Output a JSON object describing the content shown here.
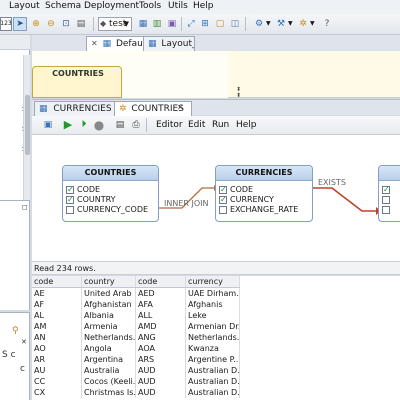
{
  "menu": [
    "Layout",
    "Schema",
    "Deployment",
    "Tools",
    "Utils",
    "Help"
  ],
  "toolbar": {
    "zoom_badge": "123",
    "database": "test"
  },
  "editor_tabs": [
    "Default",
    "Layout_"
  ],
  "layout_preview": {
    "entity": "COUNTRIES"
  },
  "query_tabs": [
    "CURRENCIES",
    "COUNTRIES"
  ],
  "query_menu": [
    "Editor",
    "Edit",
    "Run",
    "Help"
  ],
  "diagram": {
    "entities": [
      {
        "name": "COUNTRIES",
        "columns": [
          "CODE",
          "COUNTRY",
          "CURRENCY_CODE"
        ],
        "checked": [
          true,
          true,
          false
        ]
      },
      {
        "name": "CURRENCIES",
        "columns": [
          "CODE",
          "CURRENCY",
          "EXCHANGE_RATE"
        ],
        "checked": [
          true,
          true,
          false
        ]
      }
    ],
    "joins": [
      "INNER JOIN",
      "EXISTS"
    ],
    "colors": {
      "inner_join": "#b46a3c",
      "exists": "#c0402a",
      "arrow": "#2a9a30"
    }
  },
  "status": "Read 234 rows.",
  "results": {
    "columns": [
      "code",
      "country",
      "code",
      "currency"
    ],
    "rows": [
      [
        "AE",
        "United Arab ...",
        "AED",
        "UAE Dirham..."
      ],
      [
        "AF",
        "Afghanistan",
        "AFA",
        "Afghanis"
      ],
      [
        "AL",
        "Albania",
        "ALL",
        "Leke"
      ],
      [
        "AM",
        "Armenia",
        "AMD",
        "Armenian Dr..."
      ],
      [
        "AN",
        "Netherlands...",
        "ANG",
        "Netherlands..."
      ],
      [
        "AO",
        "Angola",
        "AOA",
        "Kwanza"
      ],
      [
        "AR",
        "Argentina",
        "ARS",
        "Argentine P..."
      ],
      [
        "AU",
        "Australia",
        "AUD",
        "Australian D..."
      ],
      [
        "CC",
        "Cocos (Keeli...",
        "AUD",
        "Australian D..."
      ],
      [
        "CX",
        "Christmas Is...",
        "AUD",
        "Australian D..."
      ]
    ]
  }
}
